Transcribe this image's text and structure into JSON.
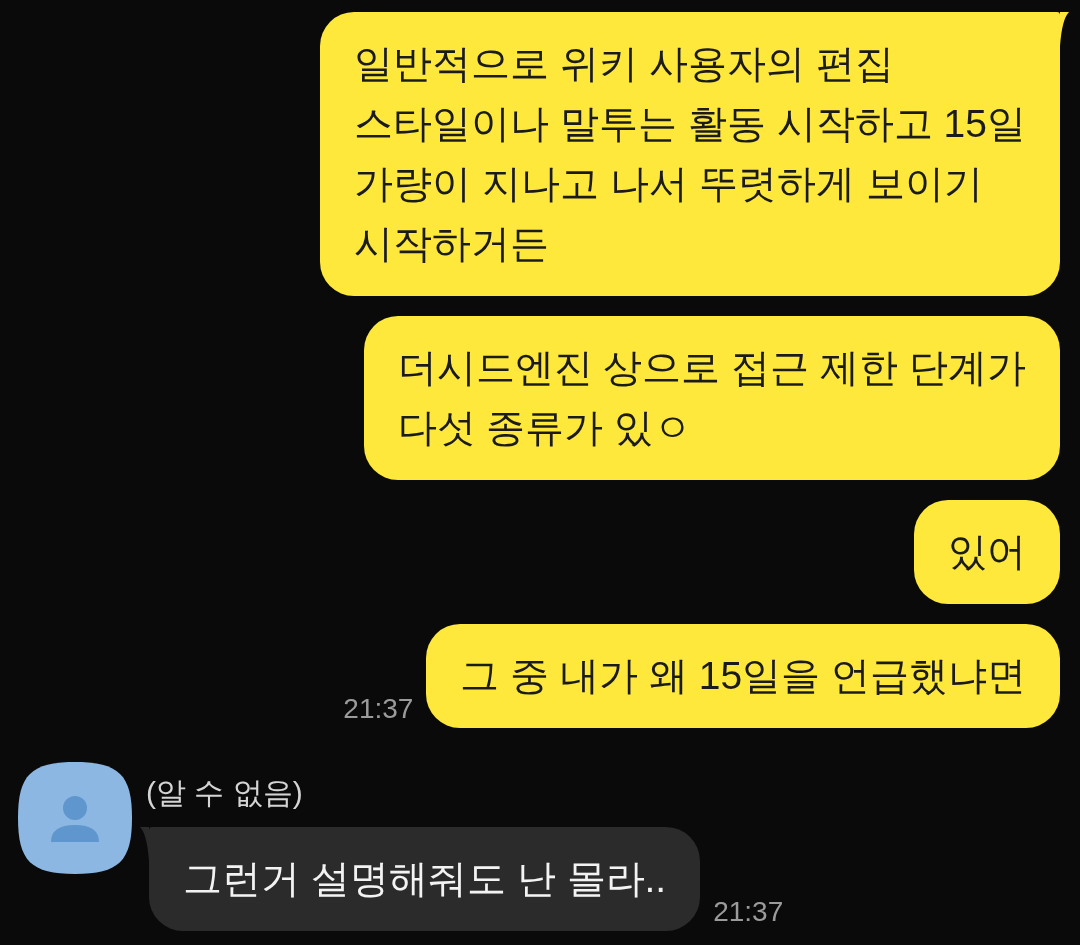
{
  "messages": [
    {
      "kind": "sent",
      "text": "일반적으로 위키 사용자의 편집\n스타일이나 말투는 활동 시작하고 15일\n가량이 지나고 나서 뚜렷하게 보이기\n시작하거든",
      "tail": true
    },
    {
      "kind": "sent",
      "text": "더시드엔진 상으로 접근 제한 단계가\n다섯 종류가 있ㅇ",
      "tail": false
    },
    {
      "kind": "sent",
      "text": "있어",
      "tail": false
    },
    {
      "kind": "sent",
      "text": "그 중 내가 왜 15일을 언급했냐면",
      "tail": false,
      "time": "21:37"
    },
    {
      "kind": "received",
      "sender": "(알 수 없음)",
      "text": "그런거 설명해줘도 난 몰라..",
      "tail": true,
      "time": "21:37"
    }
  ]
}
